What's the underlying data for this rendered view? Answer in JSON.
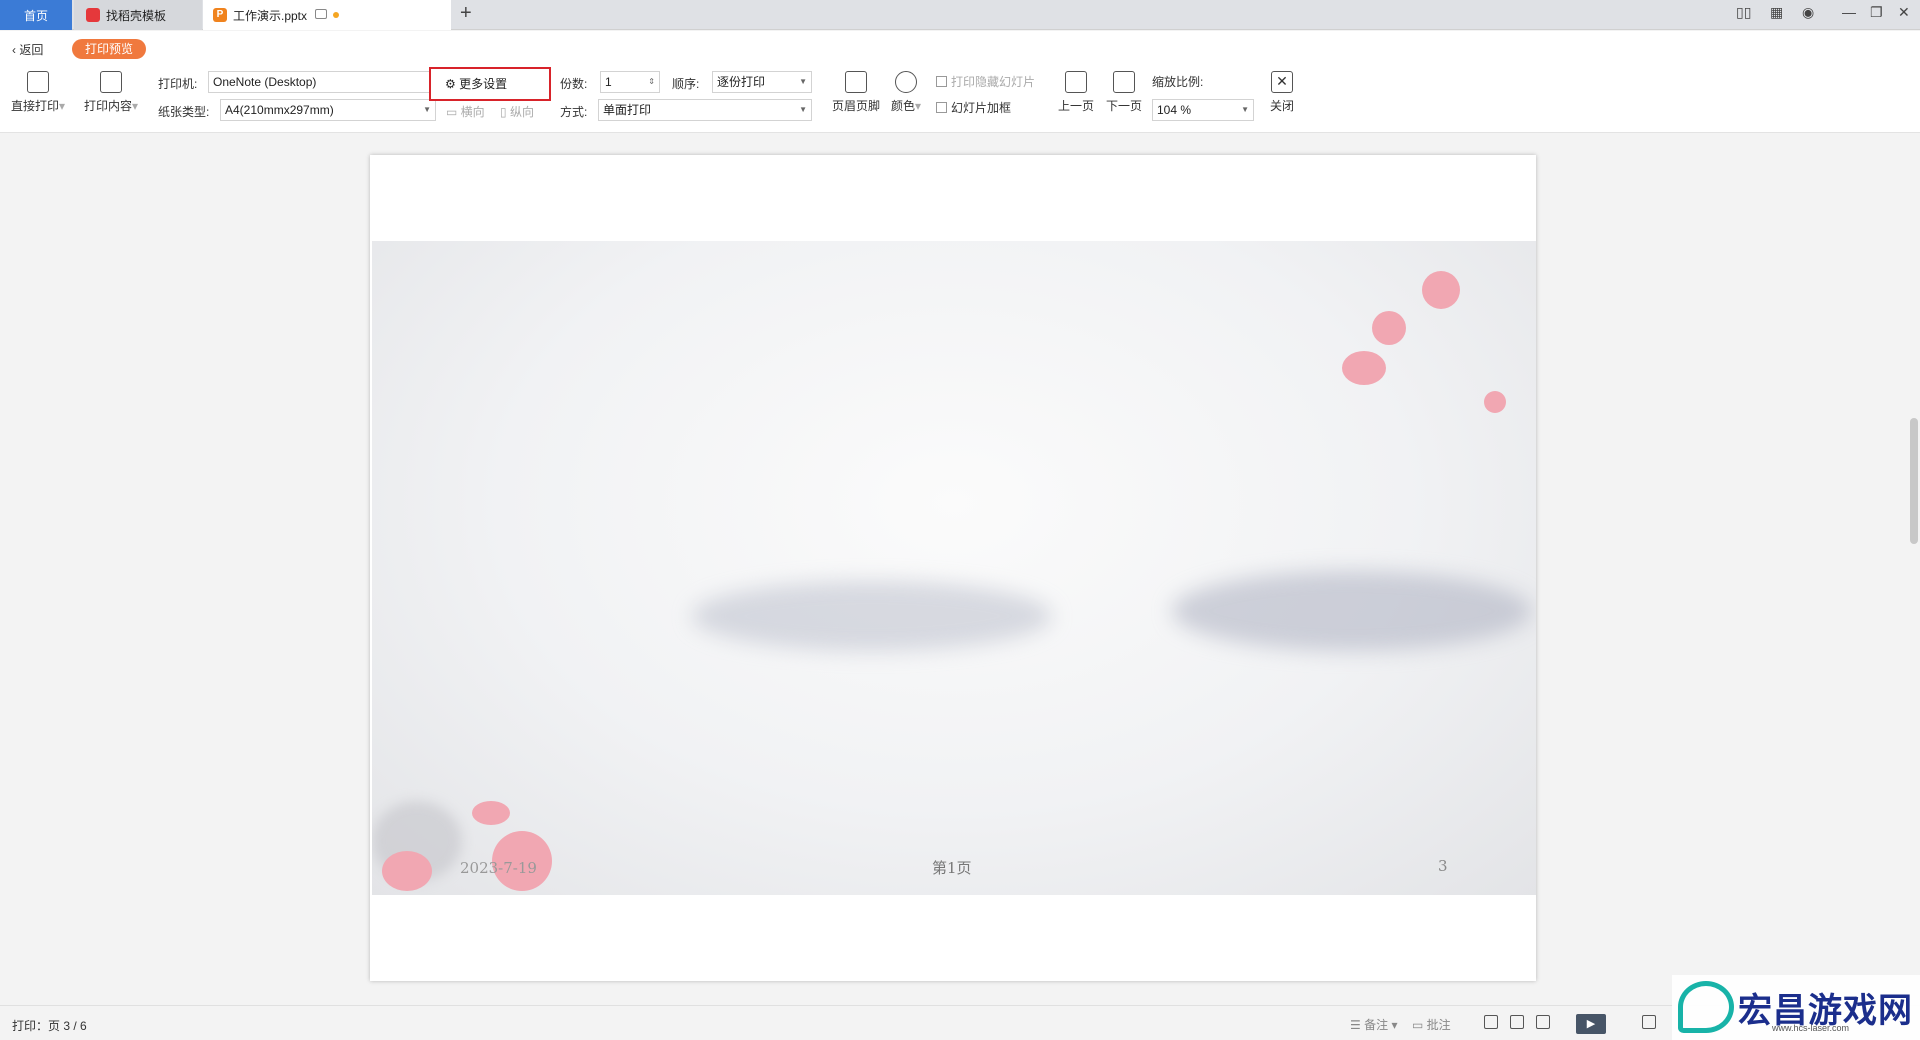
{
  "tabs": {
    "home": "首页",
    "template": "找稻壳模板",
    "document": "工作演示.pptx"
  },
  "toolbar": {
    "back": "返回",
    "mode_badge": "打印预览",
    "direct_print": "直接打印",
    "print_content": "打印内容",
    "printer_label": "打印机:",
    "printer_value": "OneNote (Desktop)",
    "paper_label": "纸张类型:",
    "paper_value": "A4(210mmx297mm)",
    "landscape": "横向",
    "portrait": "纵向",
    "more_settings": "更多设置",
    "copies_label": "份数:",
    "copies_value": "1",
    "order_label": "顺序:",
    "order_value": "逐份打印",
    "method_label": "方式:",
    "method_value": "单面打印",
    "header_footer": "页眉页脚",
    "color": "颜色",
    "print_hidden": "打印隐藏幻灯片",
    "slide_frame": "幻灯片加框",
    "prev_page": "上一页",
    "next_page": "下一页",
    "zoom_label": "缩放比例:",
    "zoom_value": "104 %",
    "close": "关闭"
  },
  "slide": {
    "date": "2023-7-19",
    "page_text": "第1页",
    "number": "3"
  },
  "status": {
    "print_info": "打印：页 3 / 6",
    "notes": "备注",
    "comments": "批注"
  },
  "watermark": {
    "title": "宏昌游戏网",
    "url": "www.hcs-laser.com"
  },
  "colors": {
    "accent": "#3b7bd6",
    "badge": "#f0793e",
    "highlight_box": "#d8232a"
  }
}
